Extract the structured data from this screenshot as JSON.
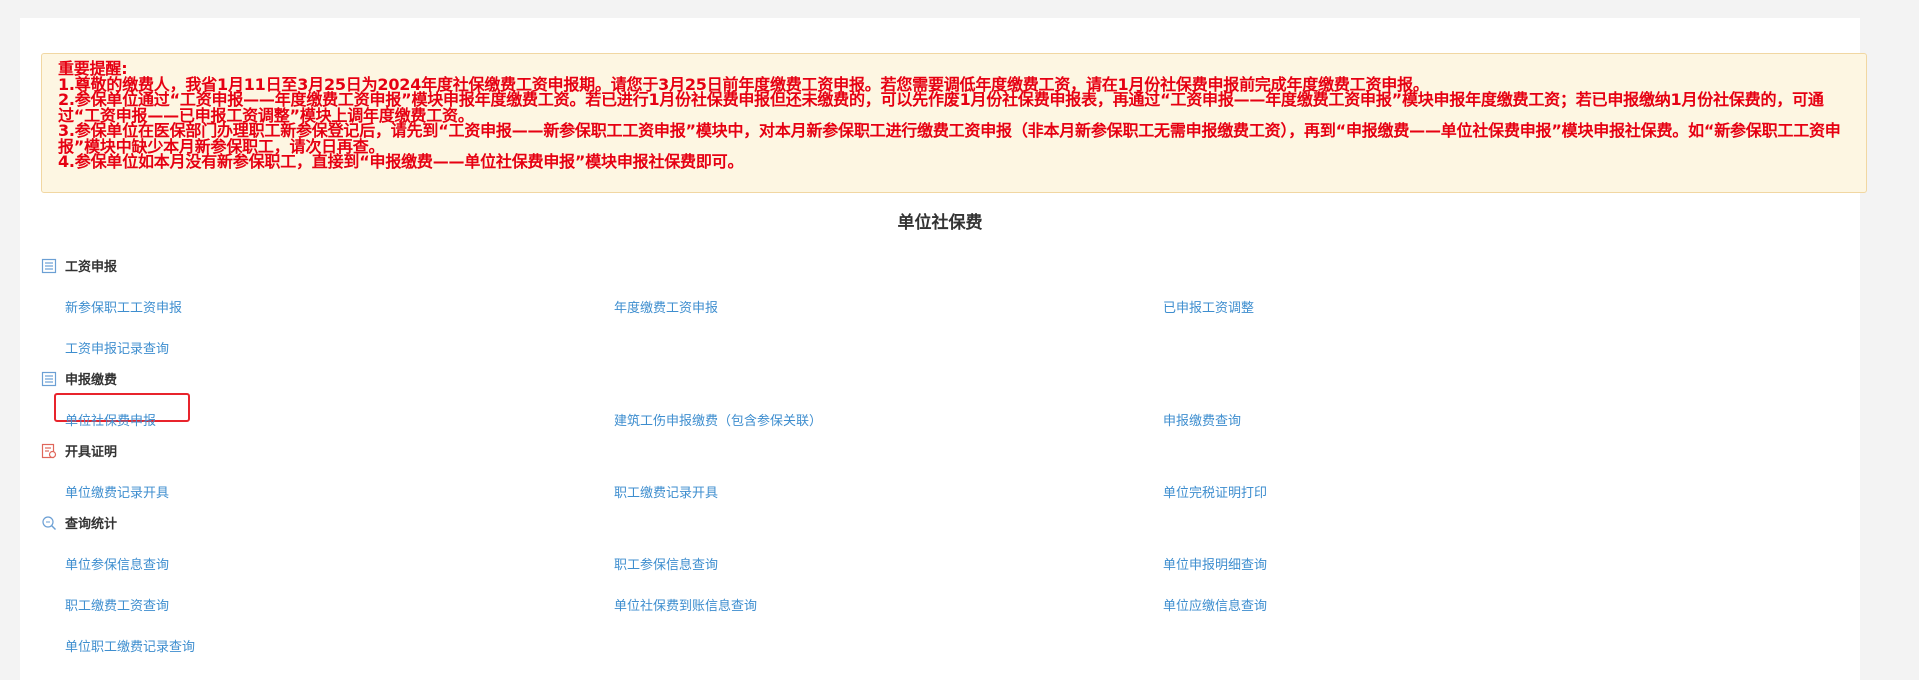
{
  "notice": {
    "title": "重要提醒:",
    "lines": [
      "1.尊敬的缴费人，我省1月11日至3月25日为2024年度社保缴费工资申报期。请您于3月25日前年度缴费工资申报。若您需要调低年度缴费工资，请在1月份社保费申报前完成年度缴费工资申报。",
      "2.参保单位通过“工资申报——年度缴费工资申报”模块申报年度缴费工资。若已进行1月份社保费申报但还未缴费的，可以先作废1月份社保费申报表，再通过“工资申报——年度缴费工资申报”模块申报年度缴费工资；若已申报缴纳1月份社保费的，可通过“工资申报——已申报工资调整”模块上调年度缴费工资。",
      "3.参保单位在医保部门办理职工新参保登记后，请先到“工资申报——新参保职工工资申报”模块中，对本月新参保职工进行缴费工资申报（非本月新参保职工无需申报缴费工资），再到“申报缴费——单位社保费申报”模块申报社保费。如“新参保职工工资申报”模块中缺少本月新参保职工，请次日再查。",
      "4.参保单位如本月没有新参保职工，直接到“申报缴费——单位社保费申报”模块申报社保费即可。"
    ]
  },
  "page_title": "单位社保费",
  "sections": {
    "wage": {
      "icon": "list-icon",
      "title": "工资申报",
      "links": [
        "新参保职工工资申报",
        "年度缴费工资申报",
        "已申报工资调整",
        "工资申报记录查询"
      ]
    },
    "declare": {
      "icon": "list-icon",
      "title": "申报缴费",
      "links": [
        "单位社保费申报",
        "建筑工伤申报缴费（包含参保关联）",
        "申报缴费查询"
      ]
    },
    "cert": {
      "icon": "certificate-icon",
      "title": "开具证明",
      "links": [
        "单位缴费记录开具",
        "职工缴费记录开具",
        "单位完税证明打印"
      ]
    },
    "query": {
      "icon": "search-icon",
      "title": "查询统计",
      "links": [
        "单位参保信息查询",
        "职工参保信息查询",
        "单位申报明细查询",
        "职工缴费工资查询",
        "单位社保费到账信息查询",
        "单位应缴信息查询",
        "单位职工缴费记录查询"
      ]
    }
  },
  "colors": {
    "notice_text": "#e60012",
    "notice_bg": "#fdf6e2",
    "link": "#3e8ecf",
    "highlight_box": "#e8242c"
  }
}
